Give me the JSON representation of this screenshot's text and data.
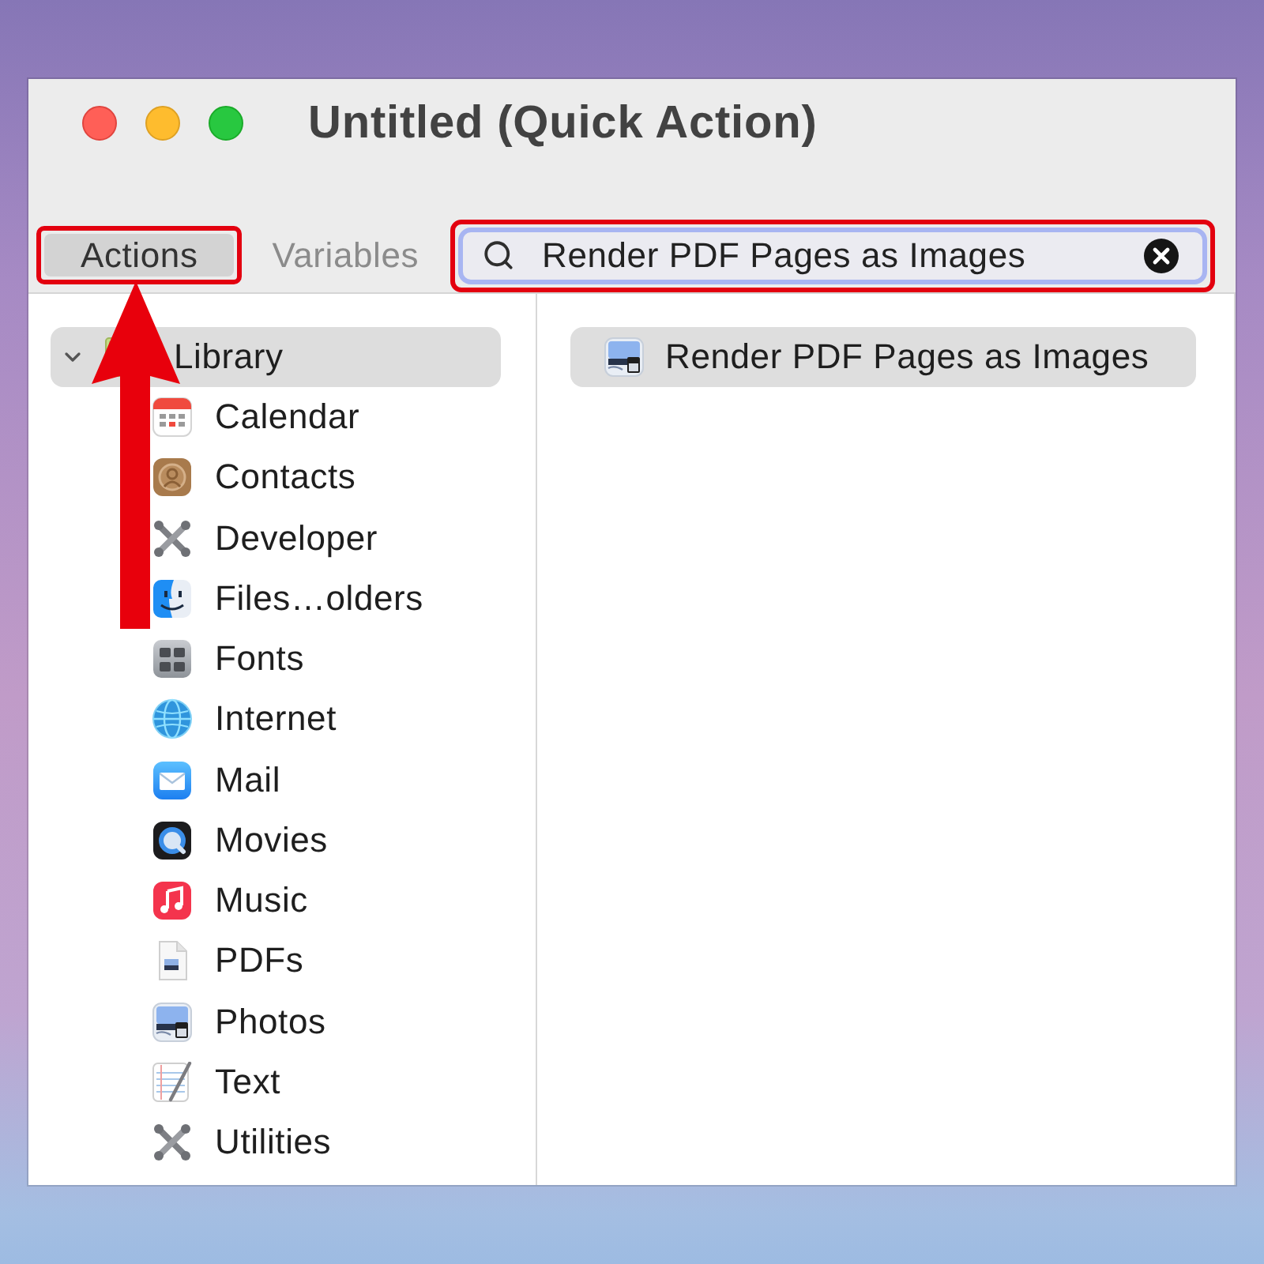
{
  "window": {
    "title": "Untitled (Quick Action)"
  },
  "tabs": [
    {
      "label": "Actions",
      "selected": true,
      "highlighted": true
    },
    {
      "label": "Variables",
      "selected": false,
      "highlighted": false
    }
  ],
  "search": {
    "value": "Render PDF Pages as Images",
    "highlighted": true
  },
  "library": {
    "label": "Library",
    "expanded": true,
    "selected": true,
    "children": [
      {
        "label": "Calendar",
        "kind": "calendar",
        "selected": false
      },
      {
        "label": "Contacts",
        "kind": "contacts",
        "selected": false
      },
      {
        "label": "Developer",
        "kind": "developer",
        "selected": false
      },
      {
        "label": "Files…olders",
        "kind": "finder",
        "selected": false
      },
      {
        "label": "Fonts",
        "kind": "fonts",
        "selected": false
      },
      {
        "label": "Internet",
        "kind": "internet",
        "selected": false
      },
      {
        "label": "Mail",
        "kind": "mail",
        "selected": false
      },
      {
        "label": "Movies",
        "kind": "movies",
        "selected": false
      },
      {
        "label": "Music",
        "kind": "music",
        "selected": false
      },
      {
        "label": "PDFs",
        "kind": "pdfs",
        "selected": false
      },
      {
        "label": "Photos",
        "kind": "photos",
        "selected": false
      },
      {
        "label": "Text",
        "kind": "text",
        "selected": false
      },
      {
        "label": "Utilities",
        "kind": "utilities",
        "selected": false
      }
    ]
  },
  "results": [
    {
      "label": "Render PDF Pages as Images",
      "kind": "photos",
      "selected": true
    }
  ]
}
